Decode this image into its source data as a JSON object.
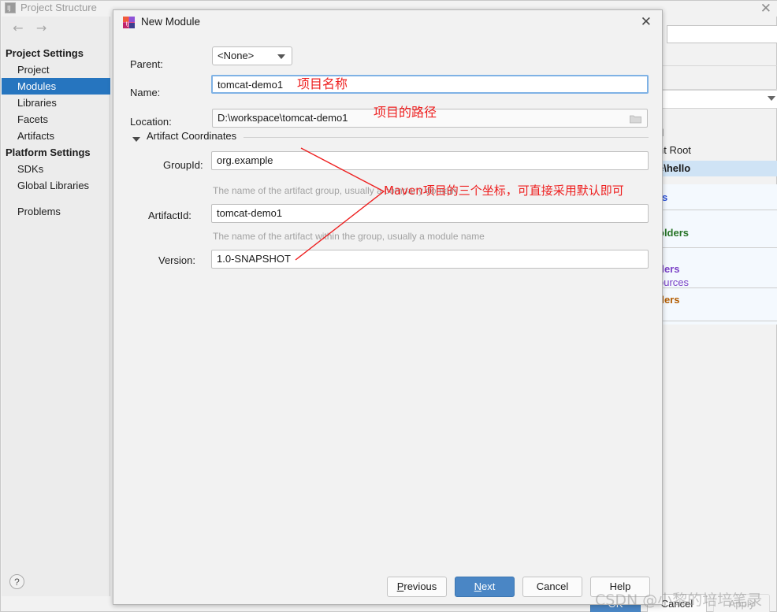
{
  "background_window": {
    "title": "Project Structure",
    "close_label": "✕",
    "nav": {
      "back": "←",
      "forward": "→"
    },
    "help_badge": "?",
    "sidebar": {
      "groups": [
        {
          "label": "Project Settings",
          "items": [
            {
              "label": "Project",
              "selected": false
            },
            {
              "label": "Modules",
              "selected": true
            },
            {
              "label": "Libraries",
              "selected": false
            },
            {
              "label": "Facets",
              "selected": false
            },
            {
              "label": "Artifacts",
              "selected": false
            }
          ]
        },
        {
          "label": "Platform Settings",
          "items": [
            {
              "label": "SDKs",
              "selected": false
            },
            {
              "label": "Global Libraries",
              "selected": false
            }
          ]
        }
      ],
      "extra_items": [
        {
          "label": "Problems"
        }
      ]
    },
    "content_fragments": {
      "content_root": "nt Root",
      "selected_path": "e\\hello",
      "source_folders_partial": "olders",
      "test_folders_partial": "ders",
      "resources_partial": "ources",
      "excluded_partial": "ders",
      "d_fragment": "d"
    },
    "buttons": [
      {
        "label": "OK",
        "style": "primary"
      },
      {
        "label": "Cancel",
        "style": "plain"
      },
      {
        "label": "Apply",
        "style": "disabled"
      }
    ]
  },
  "dialog": {
    "title": "New Module",
    "close_label": "✕",
    "fields": {
      "parent": {
        "label": "Parent:",
        "value": "<None>"
      },
      "name": {
        "label": "Name:",
        "value": "tomcat-demo1"
      },
      "location": {
        "label": "Location:",
        "value": "D:\\workspace\\tomcat-demo1"
      }
    },
    "section": {
      "label": "Artifact Coordinates",
      "expanded": true,
      "fields": {
        "group_id": {
          "label": "GroupId:",
          "value": "org.example",
          "hint": "The name of the artifact group, usually a company domain"
        },
        "artifact_id": {
          "label": "ArtifactId:",
          "value": "tomcat-demo1",
          "hint": "The name of the artifact within the group, usually a module name"
        },
        "version": {
          "label": "Version:",
          "value": "1.0-SNAPSHOT",
          "hint": ""
        }
      }
    },
    "buttons": [
      {
        "label": "Previous",
        "mnemonic": "P",
        "primary": false
      },
      {
        "label": "Next",
        "mnemonic": "N",
        "primary": true
      },
      {
        "label": "Cancel",
        "mnemonic": "",
        "primary": false
      },
      {
        "label": "Help",
        "mnemonic": "",
        "primary": false
      }
    ]
  },
  "annotations": [
    {
      "id": "name-note",
      "text": "项目名称"
    },
    {
      "id": "location-note",
      "text": "项目的路径"
    },
    {
      "id": "coords-note",
      "text": "Maven项目的三个坐标，可直接采用默认即可"
    }
  ],
  "watermark": {
    "text": "CSDN @小黎的培培笔录"
  },
  "colors": {
    "accent_blue": "#4a86c5",
    "selection_blue": "#2675bf",
    "annotation_red": "#ee2020",
    "source_green": "#267326",
    "test_purple": "#7a41c6",
    "excluded_orange": "#b35c00"
  }
}
